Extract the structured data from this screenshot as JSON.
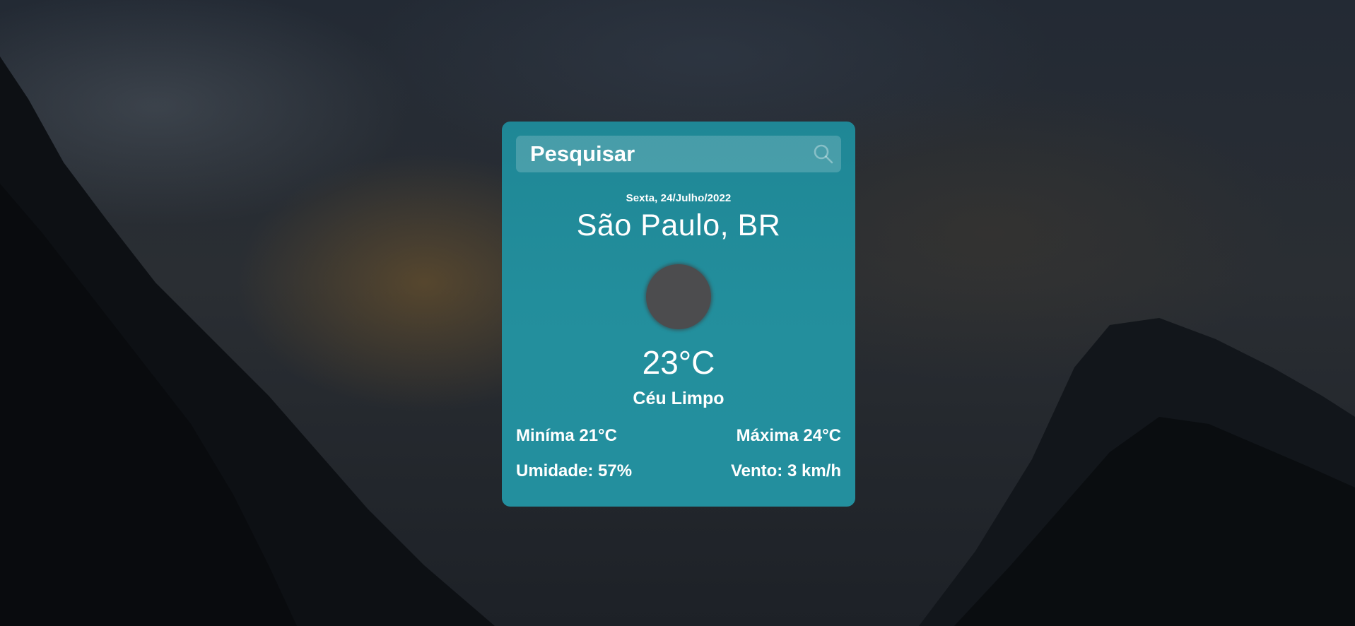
{
  "search": {
    "placeholder": "Pesquisar",
    "icon": "search-icon"
  },
  "weather": {
    "date": "Sexta, 24/Julho/2022",
    "city": "São Paulo, BR",
    "icon": "weather-condition-icon",
    "temperature": "23°C",
    "condition": "Céu Limpo",
    "min": "Miníma 21°C",
    "max": "Máxima 24°C",
    "humidity": "Umidade: 57%",
    "wind": "Vento: 3 km/h"
  },
  "colors": {
    "card": "#238f9d",
    "text": "#ffffff",
    "icon_placeholder": "#4c4c4e"
  }
}
